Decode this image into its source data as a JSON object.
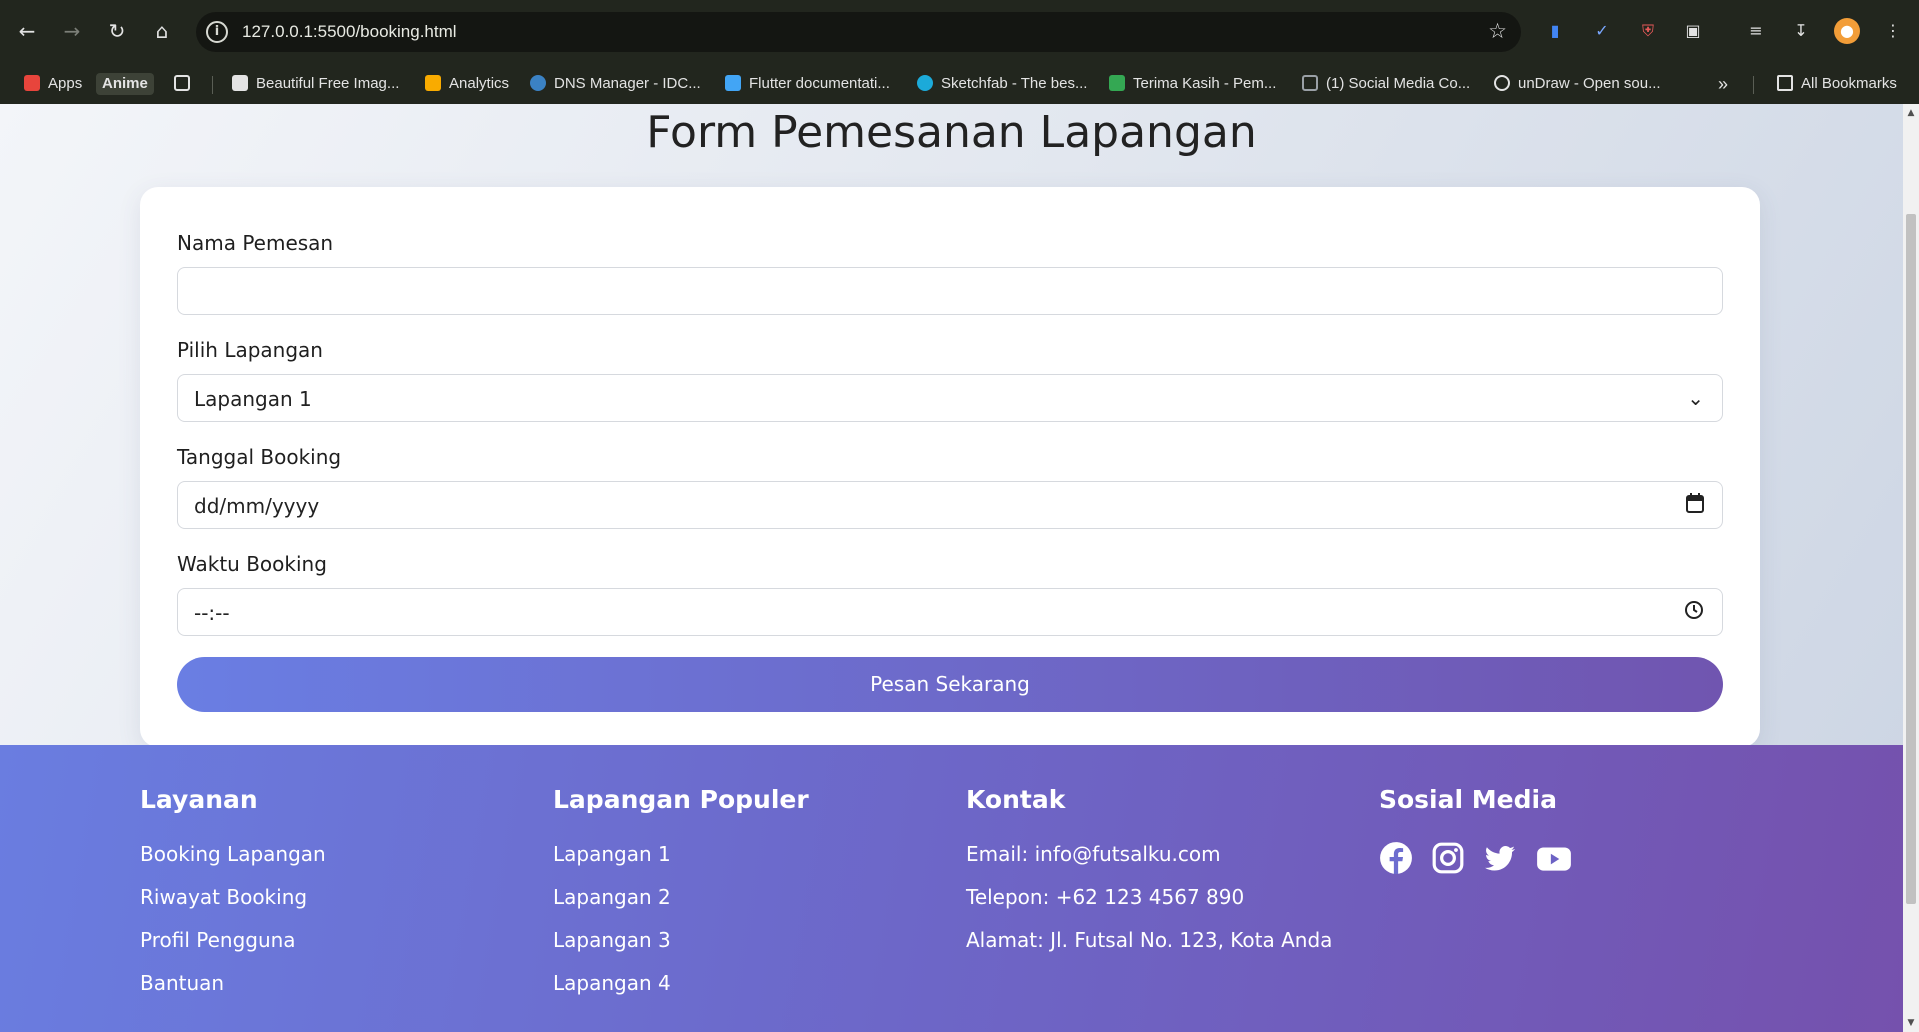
{
  "browser": {
    "url": "127.0.0.1:5500/booking.html",
    "bookmarks": [
      {
        "label": "Apps",
        "color": "#e8453c"
      },
      {
        "label": "Anime",
        "color": "#3d4237"
      },
      {
        "label": "Beautiful Free Imag...",
        "color": "#e3e3e3"
      },
      {
        "label": "Analytics",
        "color": "#f9ab00"
      },
      {
        "label": "DNS Manager - IDC...",
        "color": "#3b82c4"
      },
      {
        "label": "Flutter documentati...",
        "color": "#42a5f5"
      },
      {
        "label": "Sketchfab - The bes...",
        "color": "#1caad9"
      },
      {
        "label": "Terima Kasih - Pem...",
        "color": "#34a853"
      },
      {
        "label": "(1) Social Media Co...",
        "color": "#9aa0a6"
      },
      {
        "label": "unDraw - Open sou...",
        "color": "#e3e3e3"
      }
    ],
    "all_bookmarks": "All Bookmarks"
  },
  "form": {
    "title": "Form Pemesanan Lapangan",
    "name_label": "Nama Pemesan",
    "name_value": "",
    "field_label": "Pilih Lapangan",
    "field_selected": "Lapangan 1",
    "date_label": "Tanggal Booking",
    "date_placeholder": "dd/mm/yyyy",
    "time_label": "Waktu Booking",
    "time_placeholder": "--:--",
    "submit_label": "Pesan Sekarang"
  },
  "footer": {
    "layanan": {
      "title": "Layanan",
      "items": [
        "Booking Lapangan",
        "Riwayat Booking",
        "Profil Pengguna",
        "Bantuan"
      ]
    },
    "populer": {
      "title": "Lapangan Populer",
      "items": [
        "Lapangan 1",
        "Lapangan 2",
        "Lapangan 3",
        "Lapangan 4"
      ]
    },
    "kontak": {
      "title": "Kontak",
      "items": [
        "Email: info@futsalku.com",
        "Telepon: +62 123 4567 890",
        "Alamat: Jl. Futsal No. 123, Kota Anda"
      ]
    },
    "sosial": {
      "title": "Sosial Media",
      "icons": [
        "facebook-icon",
        "instagram-icon",
        "twitter-icon",
        "youtube-icon"
      ]
    }
  }
}
